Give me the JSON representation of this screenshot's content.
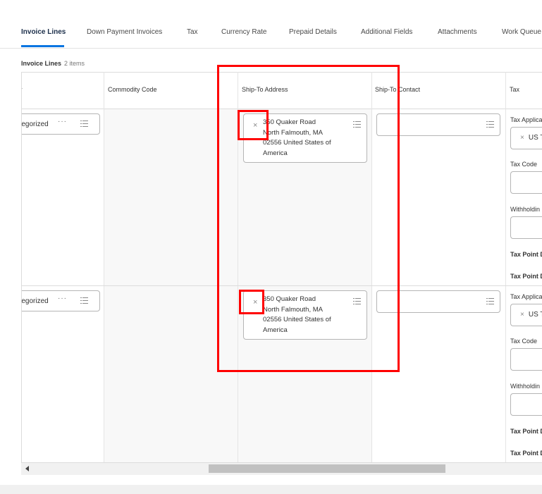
{
  "tabs": [
    {
      "label": "Invoice Lines",
      "active": true
    },
    {
      "label": "Down Payment Invoices"
    },
    {
      "label": "Tax"
    },
    {
      "label": "Currency Rate"
    },
    {
      "label": "Prepaid Details"
    },
    {
      "label": "Additional Fields"
    },
    {
      "label": "Attachments"
    },
    {
      "label": "Work Queue"
    }
  ],
  "section": {
    "title": "Invoice Lines",
    "count": "2 items"
  },
  "columns": {
    "first": "r",
    "commodity": "Commodity Code",
    "ship_to_address": "Ship-To Address",
    "ship_to_contact": "Ship-To Contact",
    "tax": "Tax"
  },
  "rows": [
    {
      "spend_category": "ategorized",
      "ship_to_address": {
        "line1": "350 Quaker Road",
        "line2": "North Falmouth, MA",
        "line3": "02556 United States of",
        "line4": "America"
      },
      "tax": {
        "applicability_label": "Tax Applica",
        "applicability_value": "US T",
        "code_label": "Tax Code",
        "withholding_label": "Withholdin",
        "point1_label": "Tax Point D",
        "point2_label": "Tax Point D"
      }
    },
    {
      "spend_category": "ategorized",
      "ship_to_address": {
        "line1": "350 Quaker Road",
        "line2": "North Falmouth, MA",
        "line3": "02556 United States of",
        "line4": "America"
      },
      "tax": {
        "applicability_label": "Tax Applica",
        "applicability_value": "US T",
        "code_label": "Tax Code",
        "withholding_label": "Withholdin",
        "point1_label": "Tax Point D",
        "point2_label": "Tax Point D"
      }
    }
  ],
  "icons": {
    "remove": "close-icon",
    "prompt": "list-icon",
    "more": "more-icon"
  },
  "colors": {
    "accent": "#0875e1",
    "highlight": "#ff0000"
  }
}
